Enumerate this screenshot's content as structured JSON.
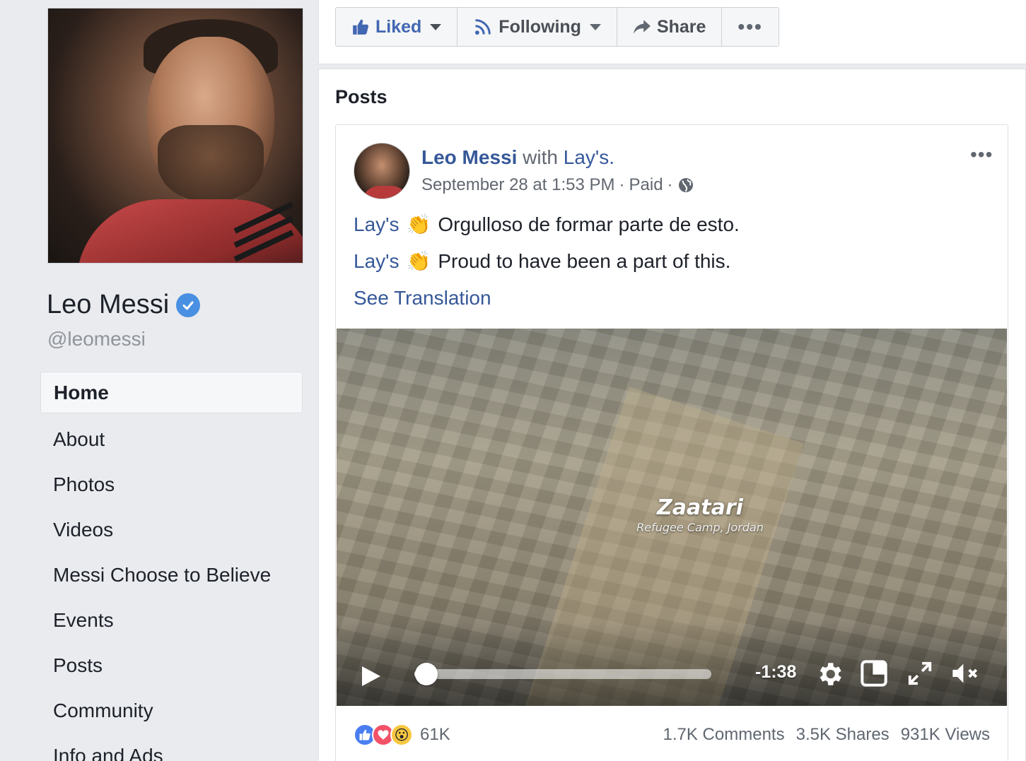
{
  "sidebar": {
    "page_name": "Leo Messi",
    "handle": "@leomessi",
    "nav": [
      {
        "label": "Home",
        "active": true
      },
      {
        "label": "About"
      },
      {
        "label": "Photos"
      },
      {
        "label": "Videos"
      },
      {
        "label": "Messi Choose to Believe"
      },
      {
        "label": "Events"
      },
      {
        "label": "Posts"
      },
      {
        "label": "Community"
      },
      {
        "label": "Info and Ads"
      }
    ]
  },
  "action_bar": {
    "liked": "Liked",
    "following": "Following",
    "share": "Share",
    "more": "•••"
  },
  "posts_section": {
    "title": "Posts"
  },
  "post": {
    "author": "Leo Messi",
    "with_text": "with",
    "tagged": "Lay's.",
    "date": "September 28 at 1:53 PM",
    "paid": "Paid",
    "separator": "·",
    "options": "•••",
    "lines": [
      {
        "tag": "Lay's",
        "emoji": "👏",
        "text": "Orgulloso de formar parte de esto."
      },
      {
        "tag": "Lay's",
        "emoji": "👏",
        "text": "Proud to have been a part of this."
      }
    ],
    "see_translation": "See Translation",
    "video": {
      "overlay_title": "Zaatari",
      "overlay_subtitle": "Refugee Camp, Jordan",
      "time_remaining": "-1:38",
      "progress": 0.04
    },
    "reactions": {
      "count": "61K",
      "wow_emoji": "😮"
    },
    "stats": {
      "comments": "1.7K Comments",
      "shares": "3.5K Shares",
      "views": "931K Views"
    }
  },
  "colors": {
    "link": "#365899",
    "page_bg": "#e9ebee",
    "verified": "#4a90e2",
    "like": "#4a7df0",
    "love": "#f25268",
    "wow": "#f7c740"
  }
}
